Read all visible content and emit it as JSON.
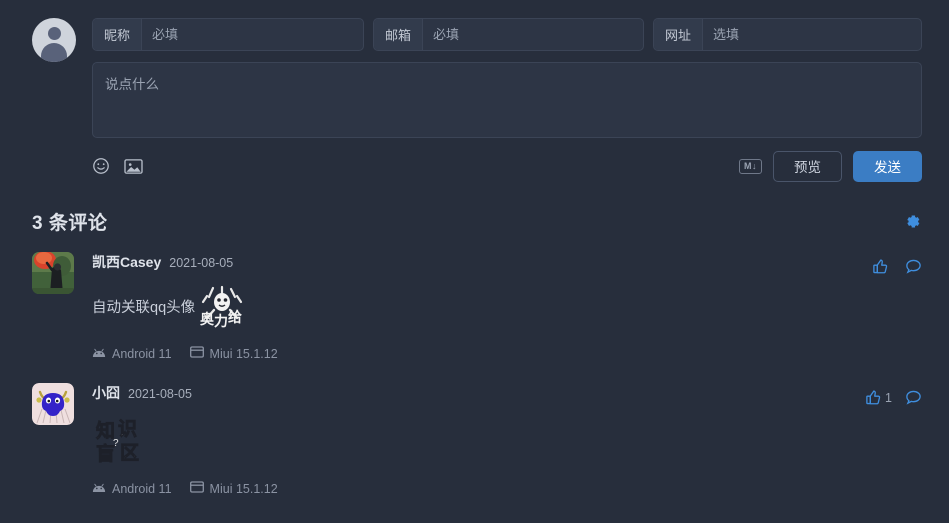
{
  "theme": {
    "background": "#272e3c",
    "field_bg": "#2d3545",
    "border": "#3b4456",
    "accent": "#3b7dc4",
    "link_blue": "#3f8ede",
    "text": "#d7dce5",
    "muted": "#9aa3b2"
  },
  "form": {
    "avatar_icon": "user-avatar-placeholder-icon",
    "fields": [
      {
        "name": "nickname",
        "label": "昵称",
        "value": "",
        "placeholder": "必填"
      },
      {
        "name": "email",
        "label": "邮箱",
        "value": "",
        "placeholder": "必填"
      },
      {
        "name": "website",
        "label": "网址",
        "value": "",
        "placeholder": "选填"
      }
    ],
    "textarea": {
      "value": "",
      "placeholder": "说点什么"
    },
    "tools": {
      "emoji_icon": "smiley-face-icon",
      "image_icon": "image-upload-icon",
      "markdown_badge": "M↓",
      "preview_label": "预览",
      "send_label": "发送"
    }
  },
  "comments_header": {
    "title": "3 条评论",
    "settings_icon": "gear-icon"
  },
  "comments": [
    {
      "author": "凯西Casey",
      "date": "2021-08-05",
      "text": "自动关联qq头像",
      "sticker": "奥力给",
      "avatar_type": "photo",
      "os": "Android 11",
      "browser": "Miui 15.1.12",
      "os_icon": "android-icon",
      "browser_icon": "browser-window-icon",
      "like_icon": "thumbs-up-icon",
      "like_count": "",
      "reply_icon": "speech-bubble-icon"
    },
    {
      "author": "小囧",
      "date": "2021-08-05",
      "text": "",
      "sticker": "知识盲区",
      "avatar_type": "monster",
      "os": "Android 11",
      "browser": "Miui 15.1.12",
      "os_icon": "android-icon",
      "browser_icon": "browser-window-icon",
      "like_icon": "thumbs-up-icon",
      "like_count": "1",
      "reply_icon": "speech-bubble-icon"
    }
  ]
}
